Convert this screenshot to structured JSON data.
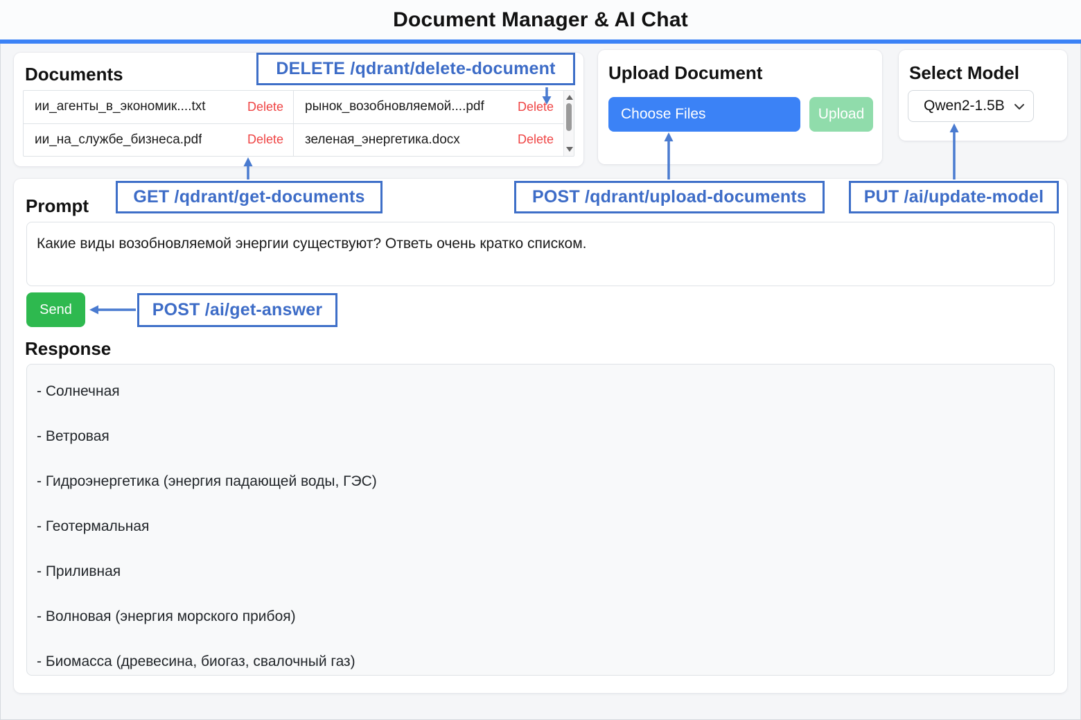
{
  "header": {
    "title": "Document Manager & AI Chat"
  },
  "documents": {
    "heading": "Documents",
    "files": [
      {
        "name": "ии_агенты_в_экономик....txt",
        "action": "Delete"
      },
      {
        "name": "рынок_возобновляемой....pdf",
        "action": "Delete"
      },
      {
        "name": "ии_на_службе_бизнеса.pdf",
        "action": "Delete"
      },
      {
        "name": "зеленая_энергетика.docx",
        "action": "Delete"
      }
    ]
  },
  "upload": {
    "heading": "Upload Document",
    "choose_files": "Choose Files",
    "upload": "Upload"
  },
  "model": {
    "heading": "Select Model",
    "selected": "Qwen2-1.5B"
  },
  "prompt": {
    "heading": "Prompt",
    "value": "Какие виды возобновляемой энергии существуют? Ответь очень кратко списком.",
    "send": "Send"
  },
  "response": {
    "heading": "Response",
    "items": [
      "- Солнечная",
      "- Ветровая",
      "- Гидроэнергетика (энергия падающей воды, ГЭС)",
      "- Геотермальная",
      "- Приливная",
      "- Волновая (энергия морского прибоя)",
      "- Биомасса (древесина, биогаз, свалочный газ)"
    ]
  },
  "annotations": {
    "delete_document": "DELETE /qdrant/delete-document",
    "get_documents": "GET /qdrant/get-documents",
    "upload_documents": "POST /qdrant/upload-documents",
    "update_model": "PUT /ai/update-model",
    "get_answer": "POST /ai/get-answer"
  },
  "colors": {
    "accent_blue": "#3b82f6",
    "annotation_blue": "#3e6fc8",
    "arrow_blue": "#4a7bd0",
    "delete_red": "#ef4444",
    "send_green": "#2eb94f",
    "upload_green": "#90dcab"
  }
}
